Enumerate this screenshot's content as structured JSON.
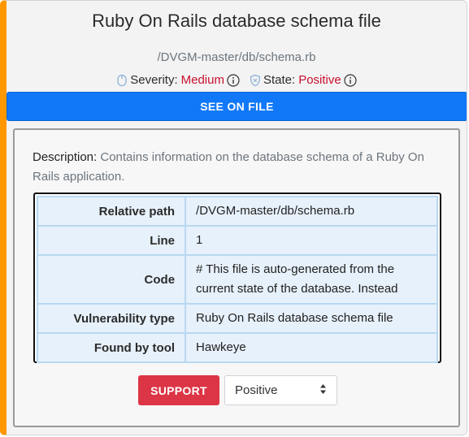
{
  "header": {
    "title": "Ruby On Rails database schema file",
    "path": "/DVGM-master/db/schema.rb",
    "severity_label": "Severity:",
    "severity_value": "Medium",
    "state_label": "State:",
    "state_value": "Positive"
  },
  "see_on_file_label": "SEE ON FILE",
  "description": {
    "label": "Description:",
    "text": "Contains information on the database schema of a Ruby On Rails application."
  },
  "details": [
    {
      "key": "Relative path",
      "value": "/DVGM-master/db/schema.rb"
    },
    {
      "key": "Line",
      "value": "1"
    },
    {
      "key": "Code",
      "value": "# This file is auto-generated from the current state of the database. Instead"
    },
    {
      "key": "Vulnerability type",
      "value": "Ruby On Rails database schema file"
    },
    {
      "key": "Found by tool",
      "value": "Hawkeye"
    }
  ],
  "support_label": "SUPPORT",
  "state_select": {
    "selected": "Positive"
  },
  "colors": {
    "accent_left": "#ff9800",
    "primary_button": "#1178f8",
    "danger_button": "#dc3545",
    "value_red": "#c8102e"
  },
  "icons": {
    "severity": "mouse-icon",
    "state": "shield-icon",
    "info": "info-circle-icon",
    "select": "sort-arrows-icon"
  }
}
